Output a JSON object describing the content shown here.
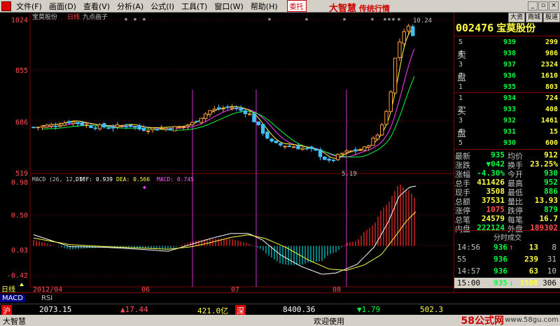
{
  "menu": {
    "items": [
      "文件(F)",
      "画面(D)",
      "查看(V)",
      "分析(A)",
      "公式(I)",
      "工具(T)",
      "窗口(W)",
      "帮助(H)"
    ],
    "trade": "委托",
    "brand": "大智慧",
    "brand_tag": "传统行情"
  },
  "chart": {
    "stock_name": "宝莫股份",
    "period": "日线",
    "drawing": "九点画子",
    "price_ticks": [
      "1024",
      "855",
      "686",
      "519"
    ],
    "max_label": "1024",
    "high_mark": "10.24",
    "low_mark": "5.19",
    "macd_ticks": [
      "0.98",
      "0.50",
      "0.03",
      "-0.42"
    ],
    "macd_header": "MACD (26, 12, 9)",
    "diff_label": "DIFF: 0.939",
    "dea_label": "DEA: 0.566",
    "macd_label": "MACD: 0.745",
    "date_labels": [
      "2012/04",
      "06",
      "07",
      "08"
    ],
    "period_tab": "日线"
  },
  "chart_data": {
    "type": "candlestick",
    "price_axis": {
      "ticks": [
        1024,
        855,
        686,
        519
      ],
      "range": [
        519,
        1024
      ]
    },
    "high": 10.24,
    "low": 5.19,
    "macd_axis": {
      "ticks": [
        0.98,
        0.5,
        0.03,
        -0.42
      ],
      "range": [
        -0.42,
        0.98
      ]
    },
    "indicators": {
      "DIFF": 0.939,
      "DEA": 0.566,
      "MACD": 0.745
    },
    "x_labels": [
      "2012/04",
      "06",
      "07",
      "08"
    ]
  },
  "quote": {
    "code": "002476",
    "name": "宝莫股份",
    "tabs": [
      "大资",
      "商城",
      "股道"
    ],
    "sell_label": [
      "卖",
      "盘"
    ],
    "buy_label": [
      "买",
      "盘"
    ],
    "asks": [
      {
        "level": "5",
        "price": "939",
        "vol": "299"
      },
      {
        "level": "4",
        "price": "938",
        "vol": "986"
      },
      {
        "level": "3",
        "price": "937",
        "vol": "2324"
      },
      {
        "level": "2",
        "price": "936",
        "vol": "1610"
      },
      {
        "level": "1",
        "price": "935",
        "vol": "803"
      }
    ],
    "bids": [
      {
        "level": "1",
        "price": "934",
        "vol": "724"
      },
      {
        "level": "2",
        "price": "933",
        "vol": "408"
      },
      {
        "level": "3",
        "price": "932",
        "vol": "1461"
      },
      {
        "level": "4",
        "price": "931",
        "vol": "15"
      },
      {
        "level": "5",
        "price": "930",
        "vol": "600"
      }
    ],
    "stats": [
      {
        "l1": "最新",
        "v1": "935",
        "l2": "均价",
        "v2": "912"
      },
      {
        "l1": "涨跌",
        "v1": "▼042",
        "l2": "换手",
        "v2": "23.25%"
      },
      {
        "l1": "涨幅",
        "v1": "-4.30%",
        "l2": "今开",
        "v2": "930"
      },
      {
        "l1": "总手",
        "v1": "411426",
        "l2": "最高",
        "v2": "952"
      },
      {
        "l1": "现手",
        "v1": "3508",
        "l2": "最低",
        "v2": "886"
      },
      {
        "l1": "总额",
        "v1": "37531",
        "l2": "量比",
        "v2": "13.93"
      },
      {
        "l1": "涨停",
        "v1": "1075",
        "l2": "跌停",
        "v2": "879"
      },
      {
        "l1": "总笔",
        "v1": "24579",
        "l2": "每笔",
        "v2": "16.7"
      },
      {
        "l1": "内盘",
        "v1": "222124",
        "l2": "外盘",
        "v2": "189302"
      }
    ],
    "trades_title": "分时成交",
    "trades": [
      {
        "time": "14:56",
        "price": "936",
        "arrow": "↑",
        "vol": "13",
        "n": "8"
      },
      {
        "time": "55",
        "price": "936",
        "arrow": "",
        "vol": "239",
        "n": "31"
      },
      {
        "time": "14:57",
        "price": "936",
        "arrow": "",
        "vol": "63",
        "n": "10"
      },
      {
        "time": "15:00",
        "price": "935",
        "arrow": "↓",
        "vol": "3508",
        "n": "306"
      }
    ]
  },
  "bottom_tabs": [
    "MACD",
    "RSI"
  ],
  "ticker": {
    "sh_mark": "沪",
    "sh_index": "2073.15",
    "sh_change": "▲17.44",
    "sh_amount": "421.0亿",
    "sz_mark": "深",
    "sz_index": "8400.36",
    "sz_change": "▼1.79",
    "sz_amount": "502.3"
  },
  "status": {
    "app": "大智慧",
    "welcome": "欢迎使用",
    "site": "58公式网",
    "site_url": "www.58gu.com"
  },
  "colors": {
    "up": "#ff5050",
    "down": "#00c0ff",
    "yellow": "#ffff40",
    "green": "#00ff40",
    "grid": "#800000",
    "macd_up": "#ff3030",
    "macd_down": "#00d0d0"
  }
}
